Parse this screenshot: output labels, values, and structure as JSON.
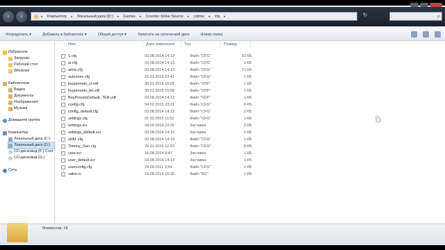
{
  "window": {
    "breadcrumbs": [
      "Компьютер",
      "Локальный диск (D:)",
      "Games",
      "Counter-Strike Source",
      "cstrike",
      "cfg"
    ],
    "search_placeholder": ""
  },
  "toolbar": {
    "organize": "Упорядочить ▾",
    "add_to_library": "Добавить в библиотеку ▾",
    "share": "Общий доступ ▾",
    "burn": "Записать на оптический диск",
    "new_folder": "Новая папка"
  },
  "sidebar": {
    "favorites": "Избранное",
    "downloads": "Загрузки",
    "desktop": "Рабочий стол",
    "windows": "Windows",
    "libraries": "Библиотеки",
    "video": "Видео",
    "documents": "Документы",
    "pictures": "Изображения",
    "music": "Музыка",
    "homegroup": "Домашняя группа",
    "computer": "Компьютер",
    "local_c": "Локальный диск (C:)",
    "local_d": "Локальный диск (D:)",
    "cd_f": "CD-дисковод (F:) Conr",
    "cd_g": "CD-дисковод (G:)",
    "network": "Сеть"
  },
  "columns": {
    "name": "Имя",
    "date": "Дата изменения",
    "type": "Тип",
    "size": "Размер"
  },
  "files": [
    {
      "name": "1.cfg",
      "date": "03.08.2014 14:13",
      "type": "Файл \"CFG\"",
      "size": "92 КБ"
    },
    {
      "name": "ai.cfg",
      "date": "03.08.2014 14:13",
      "type": "Файл \"CFG\"",
      "size": "1 КБ"
    },
    {
      "name": "aime.cfg",
      "date": "03.08.2014 14:13",
      "type": "Файл \"CFG\"",
      "size": "71 КБ"
    },
    {
      "name": "autoexec.cfg",
      "date": "31.01.2015 23:41",
      "type": "Файл \"CFG\"",
      "size": "1 КБ"
    },
    {
      "name": "buypresets_ct.vdf",
      "date": "30.01.2015 16:02",
      "type": "Файл \"VDF\"",
      "size": "1 КБ"
    },
    {
      "name": "buypresets_ter.vdf",
      "date": "30.01.2015 15:59",
      "type": "Файл \"VDF\"",
      "size": "1 КБ"
    },
    {
      "name": "BuyPresetsDefault_TER.vdf",
      "date": "03.08.2014 14:13",
      "type": "Файл \"VDF\"",
      "size": "1 КБ"
    },
    {
      "name": "config.cfg",
      "date": "04.02.2015 23:21",
      "type": "Файл \"CFG\"",
      "size": "6 КБ"
    },
    {
      "name": "config_default.cfg",
      "date": "03.08.2014 14:13",
      "type": "Файл \"CFG\"",
      "size": "2 КБ"
    },
    {
      "name": "settings.cfg",
      "date": "01.02.2015 11:52",
      "type": "Файл \"CFG\"",
      "size": "1 КБ"
    },
    {
      "name": "settings.scr",
      "date": "04.09.2014 23:26",
      "type": "Заставка",
      "size": "3 КБ"
    },
    {
      "name": "settings_default.scr",
      "date": "03.08.2014 14:13",
      "type": "Заставка",
      "size": "3 КБ"
    },
    {
      "name": "skill1.cfg",
      "date": "03.08.2014 14:13",
      "type": "Файл \"CFG\"",
      "size": "1 КБ"
    },
    {
      "name": "Tommy_Gun.cfg",
      "date": "29.01.2015 12:23",
      "type": "Файл \"CFG\"",
      "size": "6 КБ"
    },
    {
      "name": "user.scr",
      "date": "16.08.2014 9:47",
      "type": "Заставка",
      "size": "1 КБ"
    },
    {
      "name": "user_default.scr",
      "date": "03.08.2014 14:13",
      "type": "Заставка",
      "size": "1 КБ"
    },
    {
      "name": "userconfig.cfg",
      "date": "24.09.2011 3:54",
      "type": "Файл \"CFG\"",
      "size": "1 КБ"
    },
    {
      "name": "valve.rc",
      "date": "16.08.2014 15:39",
      "type": "Файл \"RC\"",
      "size": "1 КБ"
    }
  ],
  "status": {
    "items_count": "Элементов: 18"
  }
}
